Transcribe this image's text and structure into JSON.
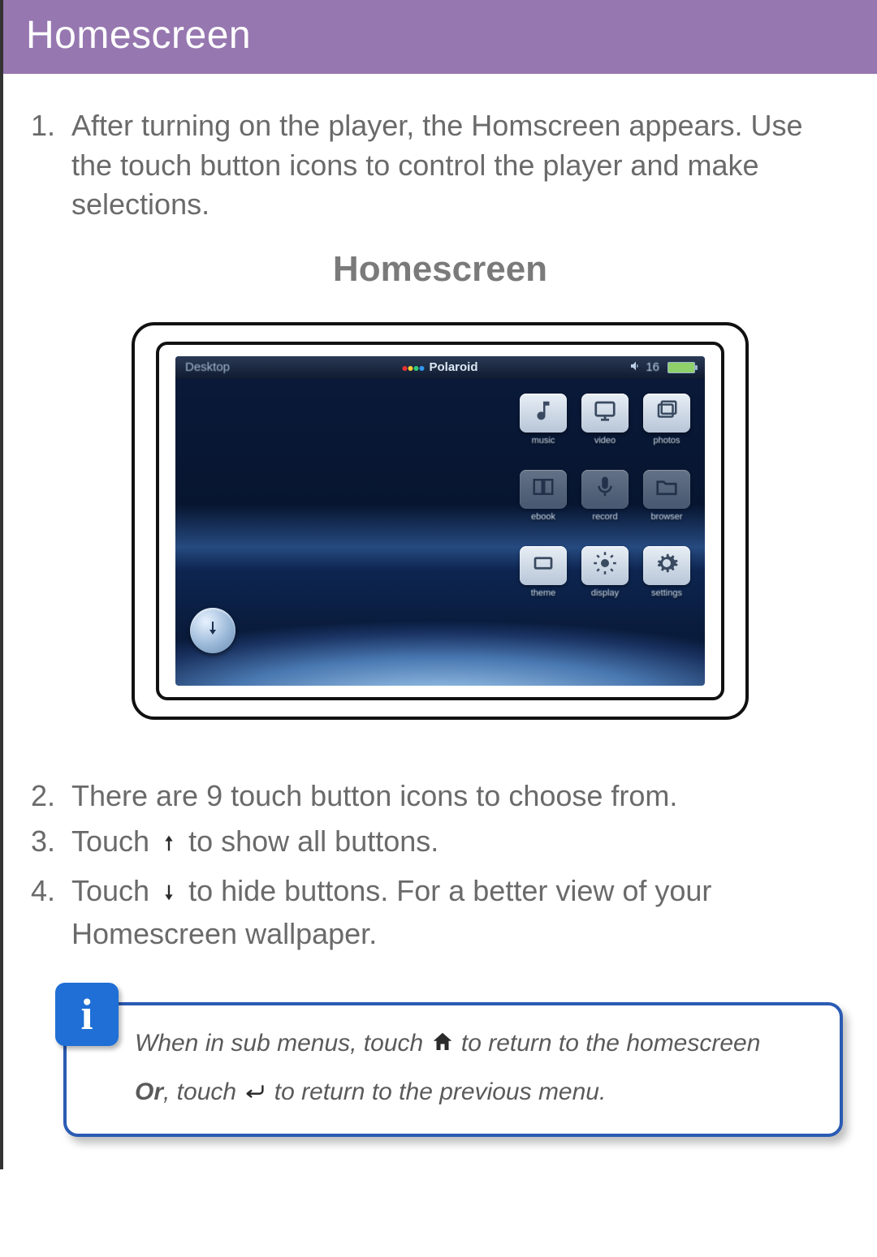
{
  "header": {
    "title": "Homescreen"
  },
  "subheading": "Homescreen",
  "steps": [
    "After turning on the player, the Homscreen appears.  Use the touch button icons to control the player and make selections.",
    "There are 9 touch button icons to choose from.",
    {
      "pre": "Touch ",
      "post": " to show all buttons."
    },
    {
      "pre": "Touch ",
      "post": " to hide buttons.  For a better view of your Homescreen wallpaper."
    }
  ],
  "device": {
    "desktop_label": "Desktop",
    "brand": "Polaroid",
    "volume": "16",
    "apps": [
      {
        "name": "music",
        "label": "music"
      },
      {
        "name": "video",
        "label": "video"
      },
      {
        "name": "photos",
        "label": "photos"
      },
      {
        "name": "ebook",
        "label": "ebook"
      },
      {
        "name": "record",
        "label": "record"
      },
      {
        "name": "browser",
        "label": "browser"
      },
      {
        "name": "theme",
        "label": "theme"
      },
      {
        "name": "display",
        "label": "display"
      },
      {
        "name": "settings",
        "label": "settings"
      }
    ]
  },
  "info": {
    "badge": "i",
    "line1_pre": "When in sub menus, touch ",
    "line1_post": " to return to the homescreen",
    "line2_strong": "Or",
    "line2_mid": ", touch ",
    "line2_post": " to return to the previous menu."
  }
}
